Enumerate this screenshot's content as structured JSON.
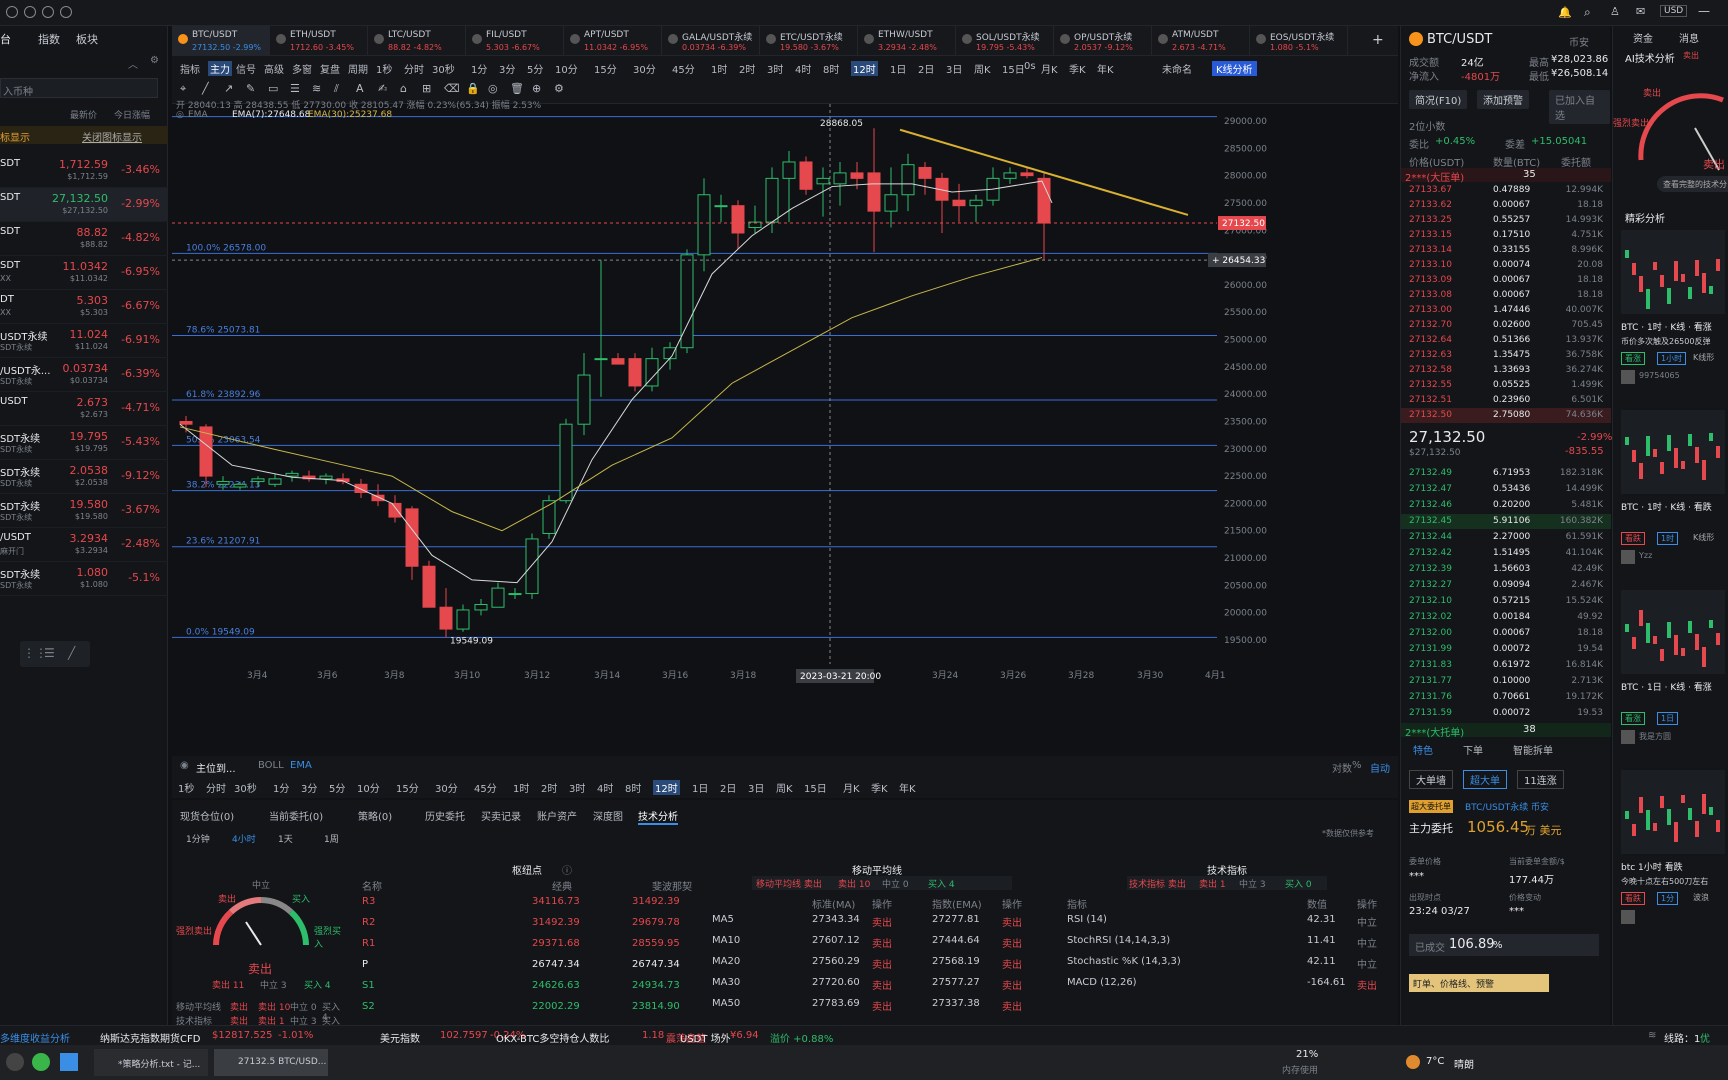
{
  "topbar": {
    "currency": "USD"
  },
  "left": {
    "tabs": [
      "台",
      "指数",
      "板块"
    ],
    "search_placeholder": "入币种",
    "col_price": "最新价",
    "col_change": "今日涨幅",
    "notice": "标显示",
    "notice_btn": "关闭图标显示",
    "rows": [
      {
        "sym": "SDT",
        "sub": "",
        "price": "1,712.59",
        "price2": "$1,712.59",
        "pct": "-3.46%"
      },
      {
        "sym": "SDT",
        "sub": "",
        "price": "27,132.50",
        "price2": "$27,132.50",
        "pct": "-2.99%"
      },
      {
        "sym": "SDT",
        "sub": "",
        "price": "88.82",
        "price2": "$88.82",
        "pct": "-4.82%"
      },
      {
        "sym": "SDT",
        "sub": "XX",
        "price": "11.0342",
        "price2": "$11.0342",
        "pct": "-6.95%"
      },
      {
        "sym": "DT",
        "sub": "XX",
        "price": "5.303",
        "price2": "$5.303",
        "pct": "-6.67%"
      },
      {
        "sym": "USDT永续",
        "sub": "SDT永续",
        "price": "11.024",
        "price2": "$11.024",
        "pct": "-6.91%"
      },
      {
        "sym": "/USDT永...",
        "sub": "SDT永续",
        "price": "0.03734",
        "price2": "$0.03734",
        "pct": "-6.39%"
      },
      {
        "sym": "USDT",
        "sub": "",
        "price": "2.673",
        "price2": "$2.673",
        "pct": "-4.71%"
      },
      {
        "sym": "SDT永续",
        "sub": "SDT永续",
        "price": "19.795",
        "price2": "$19.795",
        "pct": "-5.43%"
      },
      {
        "sym": "SDT永续",
        "sub": "SDT永续",
        "price": "2.0538",
        "price2": "$2.0538",
        "pct": "-9.12%"
      },
      {
        "sym": "SDT永续",
        "sub": "SDT永续",
        "price": "19.580",
        "price2": "$19.580",
        "pct": "-3.67%"
      },
      {
        "sym": "/USDT",
        "sub": "麻开门",
        "price": "3.2934",
        "price2": "$3.2934",
        "pct": "-2.48%"
      },
      {
        "sym": "SDT永续",
        "sub": "SDT永续",
        "price": "1.080",
        "price2": "$1.080",
        "pct": "-5.1%"
      }
    ]
  },
  "tabs": [
    {
      "name": "BTC/USDT",
      "sub": "27132.50 -2.99%"
    },
    {
      "name": "ETH/USDT",
      "sub": "1712.60 -3.45%"
    },
    {
      "name": "LTC/USDT",
      "sub": "88.82 -4.82%"
    },
    {
      "name": "FIL/USDT",
      "sub": "5.303 -6.67%"
    },
    {
      "name": "APT/USDT",
      "sub": "11.0342 -6.95%"
    },
    {
      "name": "GALA/USDT永续",
      "sub": "0.03734 -6.39%"
    },
    {
      "name": "ETC/USDT永续",
      "sub": "19.580 -3.67%"
    },
    {
      "name": "ETHW/USDT",
      "sub": "3.2934 -2.48%"
    },
    {
      "name": "SOL/USDT永续",
      "sub": "19.795 -5.43%"
    },
    {
      "name": "OP/USDT永续",
      "sub": "2.0537 -9.12%"
    },
    {
      "name": "ATM/USDT",
      "sub": "2.673 -4.71%"
    },
    {
      "name": "EOS/USDT永续",
      "sub": "1.080 -5.1%"
    }
  ],
  "toolbar1": [
    "指标",
    "主力",
    "信号",
    "高级",
    "多窗",
    "复盘",
    "周期",
    "1秒",
    "分时",
    "30秒",
    "1分",
    "3分",
    "5分",
    "10分",
    "15分",
    "30分",
    "45分",
    "1时",
    "2时",
    "3时",
    "4时",
    "8时",
    "12时",
    "1日",
    "2日",
    "3日",
    "周K",
    "15日",
    "月K",
    "季K",
    "年K"
  ],
  "toolbar1_right": {
    "time": "0s",
    "name": "未命名",
    "kline": "K线分析"
  },
  "chart": {
    "ohlc_text": "开 28040.13 高 28438.55 低 27730.00 收 28105.47 涨幅 0.23%(65.34) 振幅 2.53%",
    "ema_label": "EMA",
    "ema7": "EMA(7):27648.68",
    "ema30": "EMA(30):25237.68",
    "high_label": "28868.05",
    "low_label": "19549.09",
    "cur_price": "27132.50",
    "cross_price": "26454.33",
    "fib": [
      "100.0% 26578.00",
      "78.6% 25073.81",
      "61.8% 23892.96",
      "50.0% 23063.54",
      "38.2% 22234.13",
      "23.6% 21207.91",
      "0.0% 19549.09"
    ],
    "y_ticks": [
      "29000.00",
      "28500.00",
      "28000.00",
      "27500.00",
      "27000.00",
      "26500.00",
      "26000.00",
      "25500.00",
      "25000.00",
      "24500.00",
      "24000.00",
      "23500.00",
      "23000.00",
      "22500.00",
      "22000.00",
      "21500.00",
      "21000.00",
      "20500.00",
      "20000.00",
      "19500.00"
    ],
    "x_ticks": [
      "3月4",
      "3月6",
      "3月8",
      "3月10",
      "3月12",
      "3月14",
      "3月16",
      "3月18",
      "3月20",
      "3月24",
      "3月26",
      "3月28",
      "3月30",
      "4月1"
    ],
    "x_cursor": "2023-03-21 20:00",
    "ind_bar": [
      "主位到...",
      "BOLL",
      "EMA"
    ],
    "right_labels": [
      "对数",
      "%",
      "自动"
    ],
    "periods": [
      "1秒",
      "分时",
      "30秒",
      "1分",
      "3分",
      "5分",
      "10分",
      "15分",
      "30分",
      "45分",
      "1时",
      "2时",
      "3时",
      "4时",
      "8时",
      "12时",
      "1日",
      "2日",
      "3日",
      "周K",
      "15日",
      "月K",
      "季K",
      "年K"
    ]
  },
  "bottom": {
    "tabs": [
      "现货仓位(0)",
      "当前委托(0)",
      "策略(0)",
      "历史委托",
      "买卖记录",
      "账户资产",
      "深度图",
      "技术分析"
    ],
    "periods": [
      "1分钟",
      "4小时",
      "1天",
      "1周"
    ],
    "gauge": {
      "center": "中立",
      "left": "卖出",
      "right": "买入",
      "fl": "强烈卖出",
      "fr": "强烈买入",
      "result": "卖出",
      "leg_sell": "卖出 11",
      "leg_neu": "中立 3",
      "leg_buy": "买入 4"
    },
    "summary": [
      {
        "label": "移动平均线",
        "v": "卖出",
        "sell": "卖出 10",
        "neu": "中立 0",
        "buy": "买入 4"
      },
      {
        "label": "技术指标",
        "v": "卖出",
        "sell": "卖出 1",
        "neu": "中立 3",
        "buy": "买入 0"
      }
    ],
    "pivot": {
      "title": "枢纽点",
      "h1": "名称",
      "h2": "经典",
      "h3": "斐波那契",
      "rows": [
        [
          "R3",
          "34116.73",
          "31492.39"
        ],
        [
          "R2",
          "31492.39",
          "29679.78"
        ],
        [
          "R1",
          "29371.68",
          "28559.95"
        ],
        [
          "P",
          "26747.34",
          "26747.34"
        ],
        [
          "S1",
          "24626.63",
          "24934.73"
        ],
        [
          "S2",
          "22002.29",
          "23814.90"
        ]
      ]
    },
    "ma": {
      "title": "移动平均线",
      "h": [
        "",
        "标准(MA)",
        "操作",
        "指数(EMA)",
        "操作"
      ],
      "sum": "移动平均线 卖出",
      "sell": "卖出 10",
      "neu": "中立 0",
      "buy": "买入 4",
      "rows": [
        [
          "MA5",
          "27343.34",
          "卖出",
          "27277.81",
          "卖出"
        ],
        [
          "MA10",
          "27607.12",
          "卖出",
          "27444.64",
          "卖出"
        ],
        [
          "MA20",
          "27560.29",
          "卖出",
          "27568.19",
          "卖出"
        ],
        [
          "MA30",
          "27720.60",
          "卖出",
          "27577.27",
          "卖出"
        ],
        [
          "MA50",
          "27783.69",
          "卖出",
          "27337.38",
          "卖出"
        ]
      ]
    },
    "ti": {
      "title": "技术指标",
      "sum": "技术指标 卖出",
      "sell": "卖出 1",
      "neu": "中立 3",
      "buy": "买入 0",
      "h": [
        "指标",
        "数值",
        "操作"
      ],
      "rows": [
        [
          "RSI (14)",
          "42.31",
          "中立"
        ],
        [
          "StochRSI (14,14,3,3)",
          "11.41",
          "中立"
        ],
        [
          "Stochastic %K (14,3,3)",
          "42.11",
          "中立"
        ],
        [
          "MACD (12,26)",
          "-164.61",
          "卖出"
        ]
      ]
    },
    "watermark": "*数据仅供参考"
  },
  "ob": {
    "title": "BTC/USDT",
    "exch": "币安",
    "vol_label": "成交额",
    "vol": "24亿",
    "inflow_label": "净流入",
    "inflow": "-4801万",
    "high_label": "最高",
    "high": "¥28,023.86",
    "low_label": "最低",
    "low": "¥26,508.14",
    "btn1": "简况(F10)",
    "btn2": "添加预警",
    "btn3": "已加入自选",
    "decimals": "2位小数",
    "ratio_label": "委比",
    "ratio": "+0.45%",
    "diff_label": "委差",
    "diff": "+15.05041",
    "col1": "价格(USDT)",
    "col2": "数量(BTC)",
    "col3": "委托额",
    "ask_head": "2***(大压单)",
    "ask_count": "35",
    "asks": [
      [
        "27133.67",
        "0.47889",
        "12.994K"
      ],
      [
        "27133.62",
        "0.00067",
        "18.18"
      ],
      [
        "27133.25",
        "0.55257",
        "14.993K"
      ],
      [
        "27133.15",
        "0.17510",
        "4.751K"
      ],
      [
        "27133.14",
        "0.33155",
        "8.996K"
      ],
      [
        "27133.10",
        "0.00074",
        "20.08"
      ],
      [
        "27133.09",
        "0.00067",
        "18.18"
      ],
      [
        "27133.08",
        "0.00067",
        "18.18"
      ],
      [
        "27133.00",
        "1.47446",
        "40.007K"
      ],
      [
        "27132.70",
        "0.02600",
        "705.45"
      ],
      [
        "27132.64",
        "0.51366",
        "13.937K"
      ],
      [
        "27132.63",
        "1.35475",
        "36.758K"
      ],
      [
        "27132.58",
        "1.33693",
        "36.274K"
      ],
      [
        "27132.55",
        "0.05525",
        "1.499K"
      ],
      [
        "27132.51",
        "0.23960",
        "6.501K"
      ],
      [
        "27132.50",
        "2.75080",
        "74.636K"
      ]
    ],
    "last": "27,132.50",
    "last_usd": "$27,132.50",
    "last_pct": "-2.99%",
    "last_chg": "-835.55",
    "bids": [
      [
        "27132.49",
        "6.71953",
        "182.318K"
      ],
      [
        "27132.47",
        "0.53436",
        "14.499K"
      ],
      [
        "27132.46",
        "0.20200",
        "5.481K"
      ],
      [
        "27132.45",
        "5.91106",
        "160.382K"
      ],
      [
        "27132.44",
        "2.27000",
        "61.591K"
      ],
      [
        "27132.42",
        "1.51495",
        "41.104K"
      ],
      [
        "27132.39",
        "1.56603",
        "42.49K"
      ],
      [
        "27132.27",
        "0.09094",
        "2.467K"
      ],
      [
        "27132.10",
        "0.57215",
        "15.524K"
      ],
      [
        "27132.02",
        "0.00184",
        "49.92"
      ],
      [
        "27132.00",
        "0.00067",
        "18.18"
      ],
      [
        "27131.99",
        "0.00072",
        "19.54"
      ],
      [
        "27131.83",
        "0.61972",
        "16.814K"
      ],
      [
        "27131.77",
        "0.10000",
        "2.713K"
      ],
      [
        "27131.76",
        "0.70661",
        "19.172K"
      ],
      [
        "27131.59",
        "0.00072",
        "19.53"
      ]
    ],
    "bid_head": "2***(大托单)",
    "bid_count": "38",
    "ftabs": [
      "特色",
      "下单",
      "智能拆单"
    ],
    "chips": [
      "大单墙",
      "超大单",
      "11连涨"
    ],
    "big_tag": "超大委托单",
    "big_pair": "BTC/USDT永续 币安",
    "main_label": "主力委托",
    "main_val": "1056.45",
    "main_unit": "万 美元",
    "dir_label": "委单价格",
    "dir_val": "***",
    "amt_label": "当前委单金额/$",
    "amt_val": "177.44万",
    "time_label": "出现时点",
    "time_val": "23:24 03/27",
    "move_label": "价格变动",
    "move_val": "***",
    "done_label": "已成交",
    "done_val": "106.89",
    "done_unit": "%",
    "promo": "盯单、价格线、预警"
  },
  "rp": {
    "tabs": [
      "资金",
      "消息"
    ],
    "ai_title": "AI技术分析",
    "ai_tag": "卖出",
    "g_sell": "卖出",
    "g_strong": "强烈卖出",
    "g_result": "卖出",
    "more": "查看完整的技术分",
    "section": "精彩分析",
    "cards": [
      {
        "title": "BTC · 1时 · K线 · 看涨",
        "desc": "币价多次触及26500反弹",
        "tag": "看涨",
        "tf": "1小时",
        "kind": "K线形",
        "user": "99754065"
      },
      {
        "title": "BTC · 1时 · K线 · 看跌",
        "desc": "",
        "tag": "看跌",
        "tf": "1时",
        "kind": "K线形",
        "user": "Yzz"
      },
      {
        "title": "BTC · 1日 · K线 · 看涨",
        "desc": "",
        "tag": "看涨",
        "tf": "1日",
        "kind": "",
        "user": "我是方圆"
      },
      {
        "title": "btc 1小时 看跌",
        "desc": "今晚十点左右500刀左右",
        "tag": "看跌",
        "tf": "1分",
        "kind": "波浪",
        "user": ""
      }
    ]
  },
  "status": {
    "left": "多维度收益分析",
    "tickers": [
      {
        "name": "纳斯达克指数期货CFD",
        "val": "$12817.525",
        "pct": "-1.01%"
      },
      {
        "name": "美元指数",
        "val": "102.7597",
        "pct": "-0.24%"
      },
      {
        "name": "OKX-BTC多空持仓人数比",
        "val": "1.18",
        "pct": "震荡盘整"
      },
      {
        "name": "USDT 场外",
        "val": "¥6.94",
        "pct": "溢价 +0.88%"
      }
    ],
    "line": "线路：1",
    "line_q": "优"
  },
  "taskbar": {
    "app1": "*策略分析.txt - 记...",
    "app2": "27132.5 BTC/USD...",
    "mem": "21%",
    "mem_label": "内存使用",
    "weather": "7°C",
    "weather_desc": "晴朗"
  }
}
